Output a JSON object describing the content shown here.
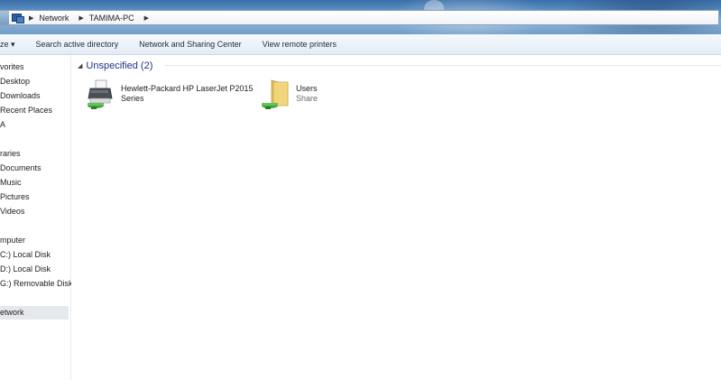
{
  "address_bar": {
    "crumbs": [
      "Network",
      "TAMIMA-PC"
    ]
  },
  "toolbar": {
    "items": [
      "ze ▾",
      "Search active directory",
      "Network and Sharing Center",
      "View remote printers"
    ]
  },
  "sidebar": {
    "items": [
      {
        "label": "vorites",
        "selected": false
      },
      {
        "label": "Desktop",
        "selected": false
      },
      {
        "label": "Downloads",
        "selected": false
      },
      {
        "label": "Recent Places",
        "selected": false
      },
      {
        "label": "A",
        "selected": false
      },
      {
        "label": "raries",
        "selected": false
      },
      {
        "label": "Documents",
        "selected": false
      },
      {
        "label": "Music",
        "selected": false
      },
      {
        "label": "Pictures",
        "selected": false
      },
      {
        "label": "Videos",
        "selected": false
      },
      {
        "label": "mputer",
        "selected": false
      },
      {
        "label": "C:) Local Disk",
        "selected": false
      },
      {
        "label": "D:) Local Disk",
        "selected": false
      },
      {
        "label": "G:) Removable Disk",
        "selected": false
      },
      {
        "label": "etwork",
        "selected": true
      }
    ]
  },
  "content": {
    "group": {
      "label": "Unspecified (2)",
      "expanded": true
    },
    "items": [
      {
        "name_line1": "Hewlett-Packard HP LaserJet P2015",
        "name_line2": "Series",
        "icon": "printer-icon"
      },
      {
        "name_line1": "Users",
        "name_line2": "Share",
        "icon": "shared-folder-icon"
      }
    ]
  }
}
